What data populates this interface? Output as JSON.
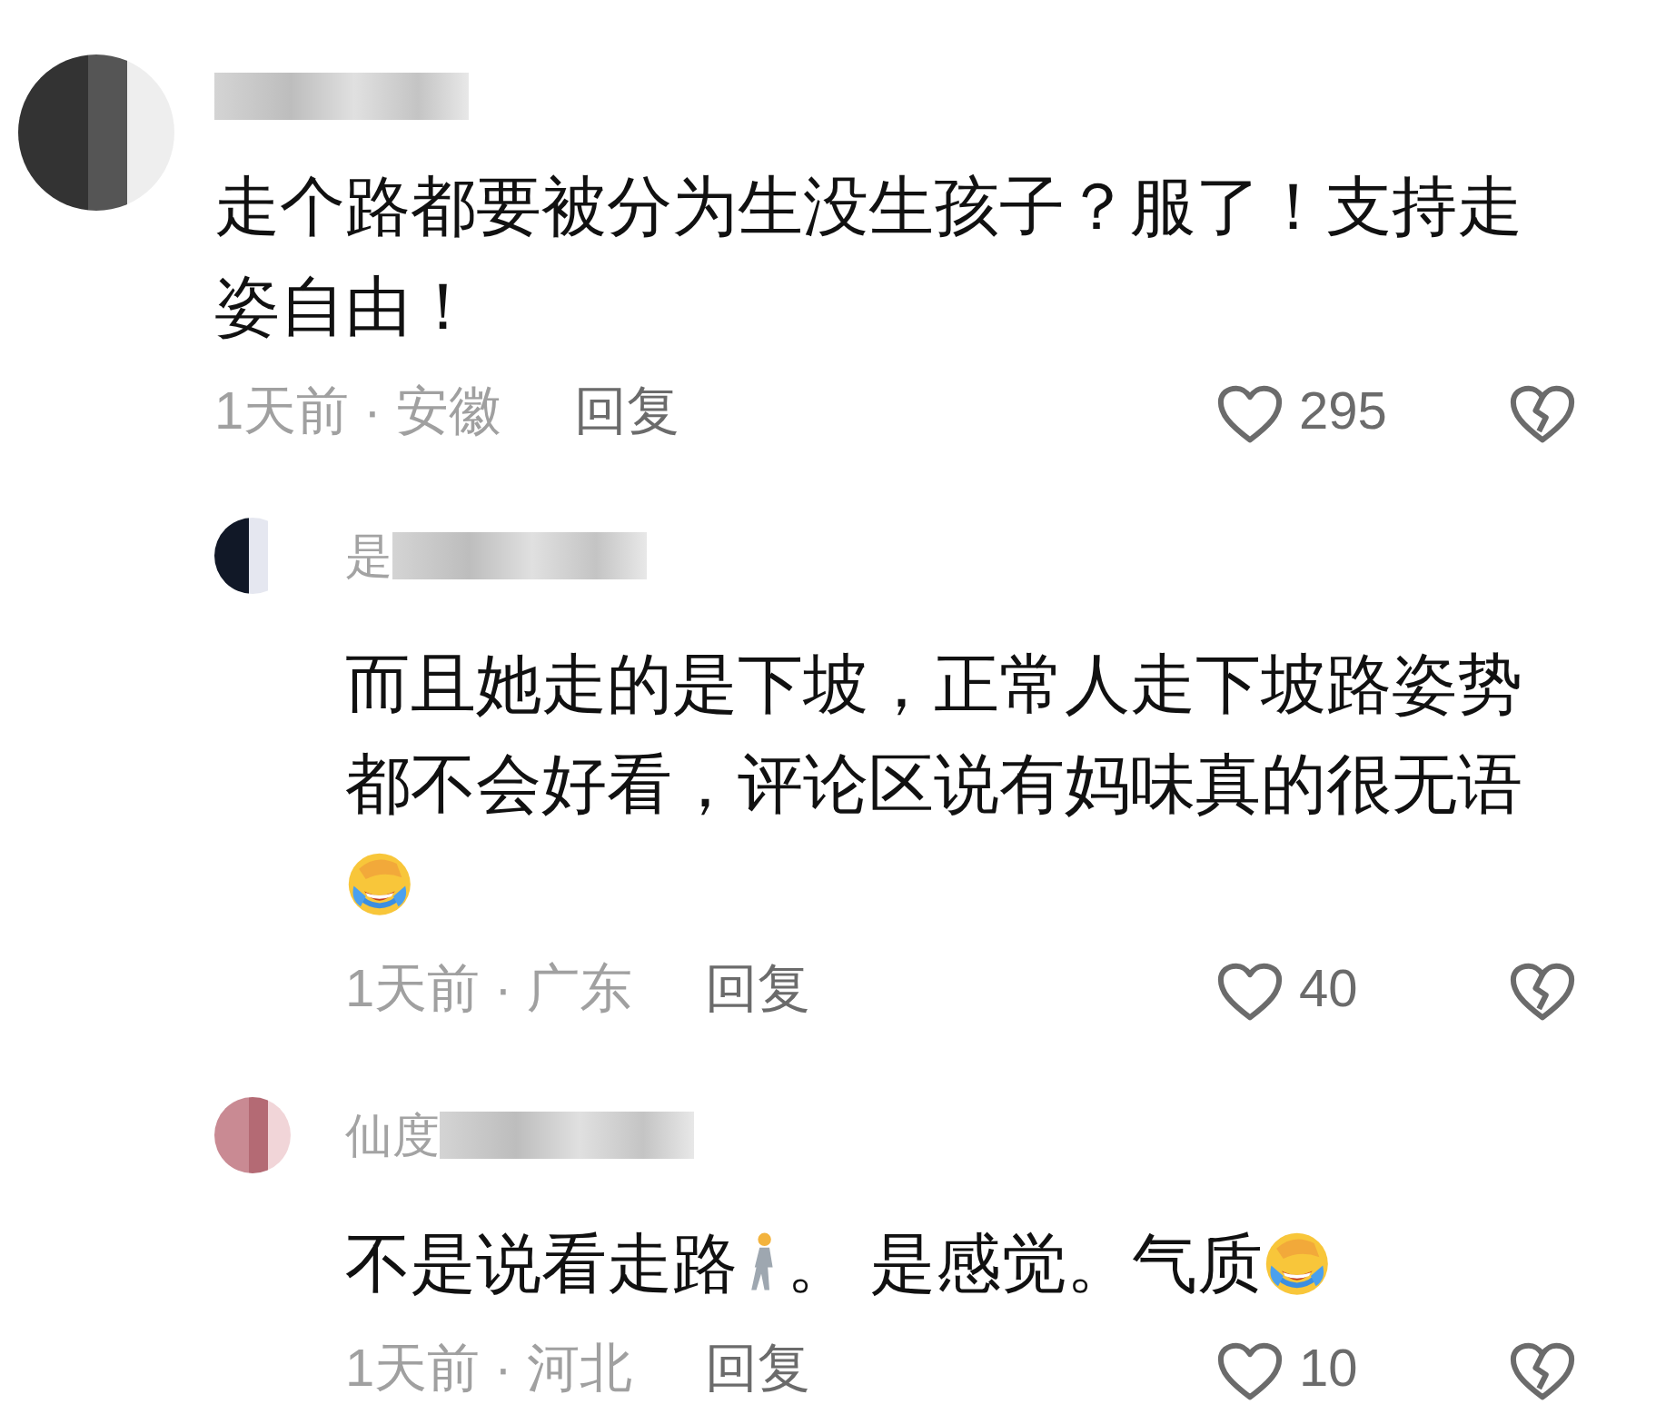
{
  "comments": [
    {
      "kind": "top",
      "body": [
        {
          "kind": "text",
          "text": "走个路都要被分为生没生孩子？服了！支持走姿自由！"
        }
      ],
      "time": "1天前",
      "separator": "·",
      "location": "安徽",
      "reply": "回复",
      "likes": "295",
      "liked": false,
      "disliked": false
    },
    {
      "kind": "reply",
      "name_visible": "是",
      "body": [
        {
          "kind": "text",
          "text": "而且她走的是下坡，正常人走下坡路姿势都不会好看，评论区说有妈味真的很无语"
        },
        {
          "kind": "crying-emoji"
        }
      ],
      "time": "1天前",
      "separator": "·",
      "location": "广东",
      "reply": "回复",
      "likes": "40",
      "liked": false,
      "disliked": false
    },
    {
      "kind": "reply",
      "name_visible": "仙度",
      "body": [
        {
          "kind": "text",
          "text": "不是说看走路"
        },
        {
          "kind": "walking-emoji"
        },
        {
          "kind": "text",
          "text": "。 是感觉。气质"
        },
        {
          "kind": "crying-emoji"
        }
      ],
      "time": "1天前",
      "separator": "·",
      "location": "河北",
      "reply": "回复",
      "likes": "10",
      "liked": false,
      "disliked": false
    }
  ]
}
